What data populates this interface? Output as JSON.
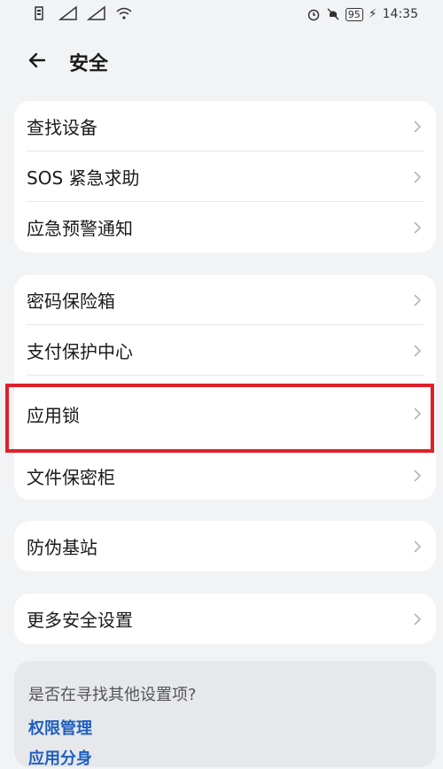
{
  "status_bar": {
    "left_icons": [
      "sim-icon",
      "signal-icon",
      "signal-icon",
      "wifi-icon"
    ],
    "battery": "95",
    "time": "14:35",
    "right_icons": [
      "alarm-icon",
      "mute-icon",
      "battery-icon",
      "charging-icon"
    ]
  },
  "header": {
    "title": "安全"
  },
  "groups": [
    {
      "items": [
        "查找设备",
        "SOS 紧急求助",
        "应急预警通知"
      ]
    },
    {
      "items": [
        "密码保险箱",
        "支付保护中心",
        "应用锁",
        "文件保密柜"
      ]
    },
    {
      "items": [
        "防伪基站"
      ]
    },
    {
      "items": [
        "更多安全设置"
      ]
    }
  ],
  "suggestions": {
    "question": "是否在寻找其他设置项?",
    "links": [
      "权限管理",
      "应用分身"
    ]
  },
  "colors": {
    "highlight": "#e0212a",
    "link": "#1f5fbf"
  }
}
